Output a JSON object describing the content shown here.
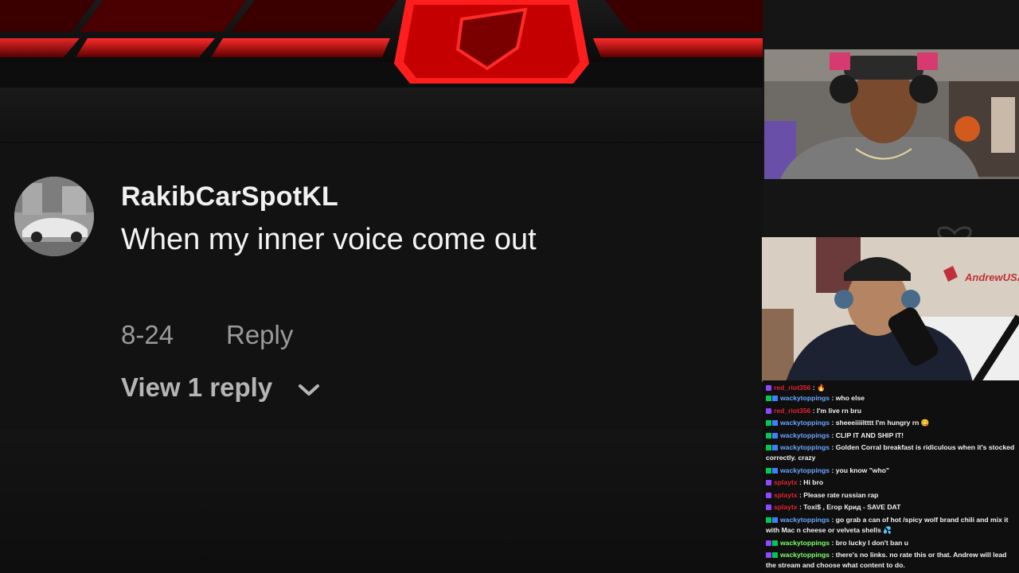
{
  "comment": {
    "username": "RakibCarSpotKL",
    "text": "When my inner voice come out",
    "date": "8-24",
    "reply_label": "Reply",
    "view_replies_label": "View 1 reply"
  },
  "stream": {
    "streamer_label": "AndrewUSATX",
    "accent_color": "#c0303a"
  },
  "chat": {
    "messages": [
      {
        "user": "red_riot356",
        "user_color": "#e0242e",
        "badges": [
          "purple"
        ],
        "text": "🔥"
      },
      {
        "user": "wackytoppings",
        "user_color": "#6aa6ff",
        "badges": [
          "green",
          "blue"
        ],
        "text": "who else"
      },
      {
        "user": "red_riot356",
        "user_color": "#e0242e",
        "badges": [
          "purple"
        ],
        "text": "I'm live rn bru"
      },
      {
        "user": "wackytoppings",
        "user_color": "#6aa6ff",
        "badges": [
          "green",
          "blue"
        ],
        "text": "sheeeiiiiltttt I'm hungry rn 😋"
      },
      {
        "user": "wackytoppings",
        "user_color": "#6aa6ff",
        "badges": [
          "green",
          "blue"
        ],
        "text": "CLIP IT AND SHIP IT!"
      },
      {
        "user": "wackytoppings",
        "user_color": "#6aa6ff",
        "badges": [
          "green",
          "blue"
        ],
        "text": "Golden Corral breakfast is ridiculous when it's stocked correctly. crazy"
      },
      {
        "user": "wackytoppings",
        "user_color": "#6aa6ff",
        "badges": [
          "green",
          "blue"
        ],
        "text": "you know \"who\""
      },
      {
        "user": "splaytx",
        "user_color": "#e0242e",
        "badges": [
          "purple"
        ],
        "text": "Hi bro"
      },
      {
        "user": "splaytx",
        "user_color": "#e0242e",
        "badges": [
          "purple"
        ],
        "text": "Please rate russian rap"
      },
      {
        "user": "splaytx",
        "user_color": "#e0242e",
        "badges": [
          "purple"
        ],
        "text": "Toxi$ , Егор Крид - SAVE DAT"
      },
      {
        "user": "wackytoppings",
        "user_color": "#6aa6ff",
        "badges": [
          "green",
          "blue"
        ],
        "text": "go grab a can of hot /spicy wolf brand chili and mix it with Mac n cheese or velveta shells 💦"
      },
      {
        "user": "wackytoppings",
        "user_color": "#7cff6a",
        "badges": [
          "purple",
          "green"
        ],
        "text": "bro lucky I don't ban u"
      },
      {
        "user": "wackytoppings",
        "user_color": "#7cff6a",
        "badges": [
          "purple",
          "green"
        ],
        "text": "there's no links. no rate this or that. Andrew will lead the stream and choose what content to do."
      }
    ]
  }
}
